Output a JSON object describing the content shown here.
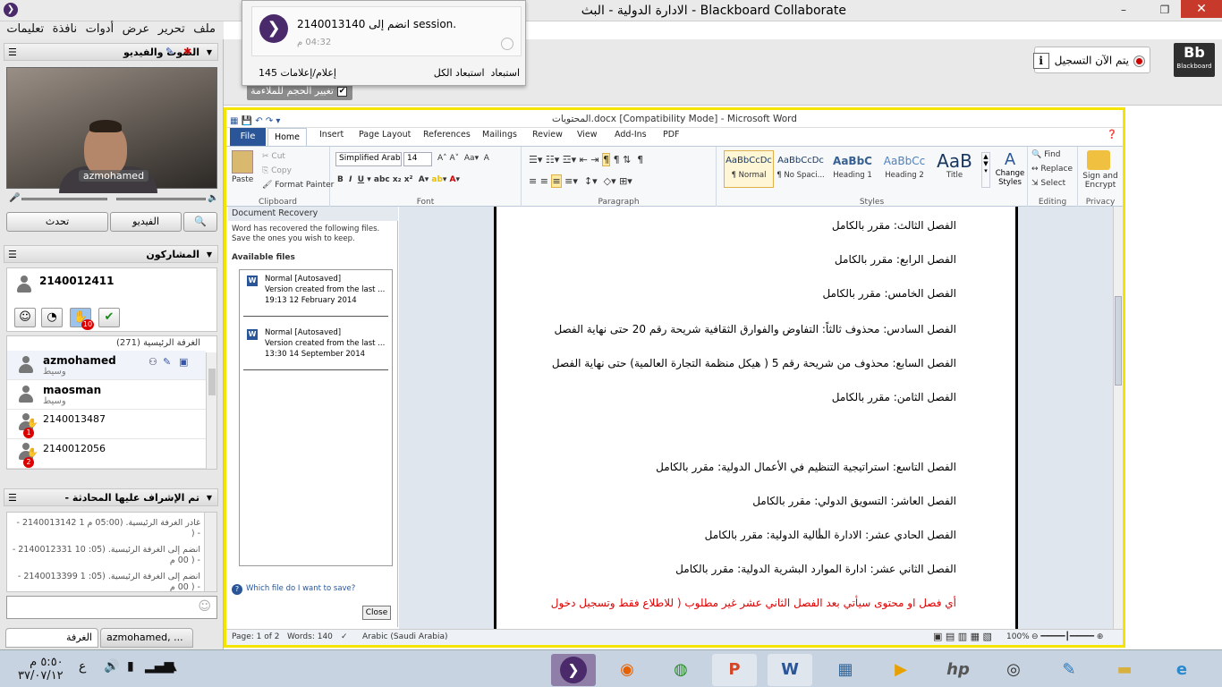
{
  "window": {
    "title": "Blackboard Collaborate - الادارة الدولية - البث",
    "controls": {
      "minimize": "–",
      "restore": "❐",
      "close": "✕"
    }
  },
  "menu": [
    "ملف",
    "تحرير",
    "عرض",
    "أدوات",
    "نافذة",
    "تعليمات"
  ],
  "notification": {
    "message": "2140013140 انضم إلى session.",
    "time": "04:32 م",
    "count_text": "145 إعلام/إعلامات",
    "exclude": "استبعاد",
    "exclude_all": "استبعاد الكل"
  },
  "toolbar": {
    "recording": "يتم الآن التسجيل",
    "brand": "Bb",
    "brand_sub": "Blackboard",
    "fit_checkbox": "تغيير الحجم للملاءمة",
    "fit_checked": "✔"
  },
  "audio_video": {
    "title": "الصوت والفيديو",
    "video_name": "azmohamed",
    "talk_button": "تحدث",
    "video_button": "الفيديو"
  },
  "participants": {
    "title": "المشاركون",
    "current_user": "2140012411",
    "hand_count": "10",
    "room_label": "الغرفة الرئيسية",
    "room_count": "(271)",
    "list": [
      {
        "name": "azmohamed",
        "role": "وسيط",
        "bold": true
      },
      {
        "name": "maosman",
        "role": "وسيط",
        "bold": true
      },
      {
        "name": "2140013487",
        "role": "",
        "bold": false,
        "hand": "1"
      },
      {
        "name": "2140012056",
        "role": "",
        "bold": false,
        "hand": "2"
      }
    ]
  },
  "chat": {
    "title": "تم الإشراف عليها المحادثة -",
    "lines": [
      "غادر الغرفة الرئيسية. (05:00 م 1 2140013142 -",
      "- (",
      "انضم إلى الغرفة الرئيسية. (05: 10 2140012331 -",
      "- ( 00 م",
      "انضم إلى الغرفة الرئيسية. (05: 1 2140013399 -",
      "- ( 00 م"
    ],
    "tabs": [
      "الغرفة",
      "azmohamed, ..."
    ]
  },
  "word": {
    "title": "المحتويات.docx [Compatibility Mode] - Microsoft Word",
    "tabs": [
      "File",
      "Home",
      "Insert",
      "Page Layout",
      "References",
      "Mailings",
      "Review",
      "View",
      "Add-Ins",
      "PDF"
    ],
    "clipboard": {
      "paste": "Paste",
      "cut": "Cut",
      "copy": "Copy",
      "format_painter": "Format Painter",
      "label": "Clipboard"
    },
    "font": {
      "name": "Simplified Arabi",
      "size": "14",
      "label": "Font"
    },
    "paragraph_label": "Paragraph",
    "styles": [
      {
        "sample": "AaBbCcDc",
        "name": "¶ Normal"
      },
      {
        "sample": "AaBbCcDc",
        "name": "¶ No Spaci..."
      },
      {
        "sample": "AaBbC",
        "name": "Heading 1"
      },
      {
        "sample": "AaBbCc",
        "name": "Heading 2"
      },
      {
        "sample": "AaB",
        "name": "Title"
      }
    ],
    "styles_label": "Styles",
    "change_styles": "Change Styles",
    "editing": {
      "find": "Find",
      "replace": "Replace",
      "select": "Select",
      "label": "Editing"
    },
    "privacy": {
      "sign": "Sign and Encrypt",
      "label": "Privacy"
    },
    "recovery": {
      "title": "Document Recovery",
      "desc": "Word has recovered the following files. Save the ones you wish to keep.",
      "available": "Available files",
      "files": [
        {
          "name": "Normal  [Autosaved]",
          "desc": "Version created from the last ...",
          "date": "19:13 12 February 2014"
        },
        {
          "name": "Normal  [Autosaved]",
          "desc": "Version created from the last ...",
          "date": "13:30 14 September 2014"
        }
      ],
      "help": "Which file do I want to save?",
      "close": "Close"
    },
    "document_lines": [
      {
        "text": "الفصل الثالث: مقرر بالكامل",
        "red": false
      },
      {
        "text": "الفصل الرابع: مقرر بالكامل",
        "red": false
      },
      {
        "text": "الفصل الخامس: مقرر بالكامل",
        "red": false
      },
      {
        "text": "الفصل السادس: محذوف ثالثاً: التفاوض والفوارق الثقافية شريحة رقم 20 حتى نهاية الفصل",
        "red": false
      },
      {
        "text": "الفصل السابع: محذوف من شريحة رقم 5 ( هيكل منظمة التجارة العالمية) حتى نهاية الفصل",
        "red": false
      },
      {
        "text": "الفصل الثامن: مقرر بالكامل",
        "red": false
      },
      {
        "text": "الفصل التاسع: استراتيجية التنظيم في الأعمال الدولية: مقرر بالكامل",
        "red": false
      },
      {
        "text": "الفصل العاشر: التسويق الدولي: مقرر بالكامل",
        "red": false
      },
      {
        "text": "الفصل الحادي عشر: الادارة المالية الدولية: مقرر بالكامل",
        "red": false
      },
      {
        "text": "الفصل الثاني عشر: ادارة الموارد البشرية الدولية: مقرر بالكامل",
        "red": false
      },
      {
        "text": "أي فصل او محتوى سيأتي بعد الفصل الثاني عشر غير مطلوب ( للاطلاع فقط وتسجيل دخول",
        "red": true
      }
    ],
    "status": {
      "page": "Page: 1 of 2",
      "words": "Words: 140",
      "language": "Arabic (Saudi Arabia)",
      "zoom": "100%"
    }
  },
  "taskbar": {
    "time": "٥:٥٠ م",
    "date": "٣٧/٠٧/١٢",
    "lang": "ع",
    "apps": [
      "bb-collaborate",
      "firefox",
      "chrome",
      "powerpoint",
      "word",
      "control-panel",
      "media-player",
      "hp",
      "media-center",
      "tool",
      "folder",
      "internet-explorer"
    ]
  },
  "colors": {
    "accent_purple": "#4a2a6a",
    "word_blue": "#2a5699",
    "recording_red": "#cc0000",
    "yellow_frame": "#f5e400"
  }
}
